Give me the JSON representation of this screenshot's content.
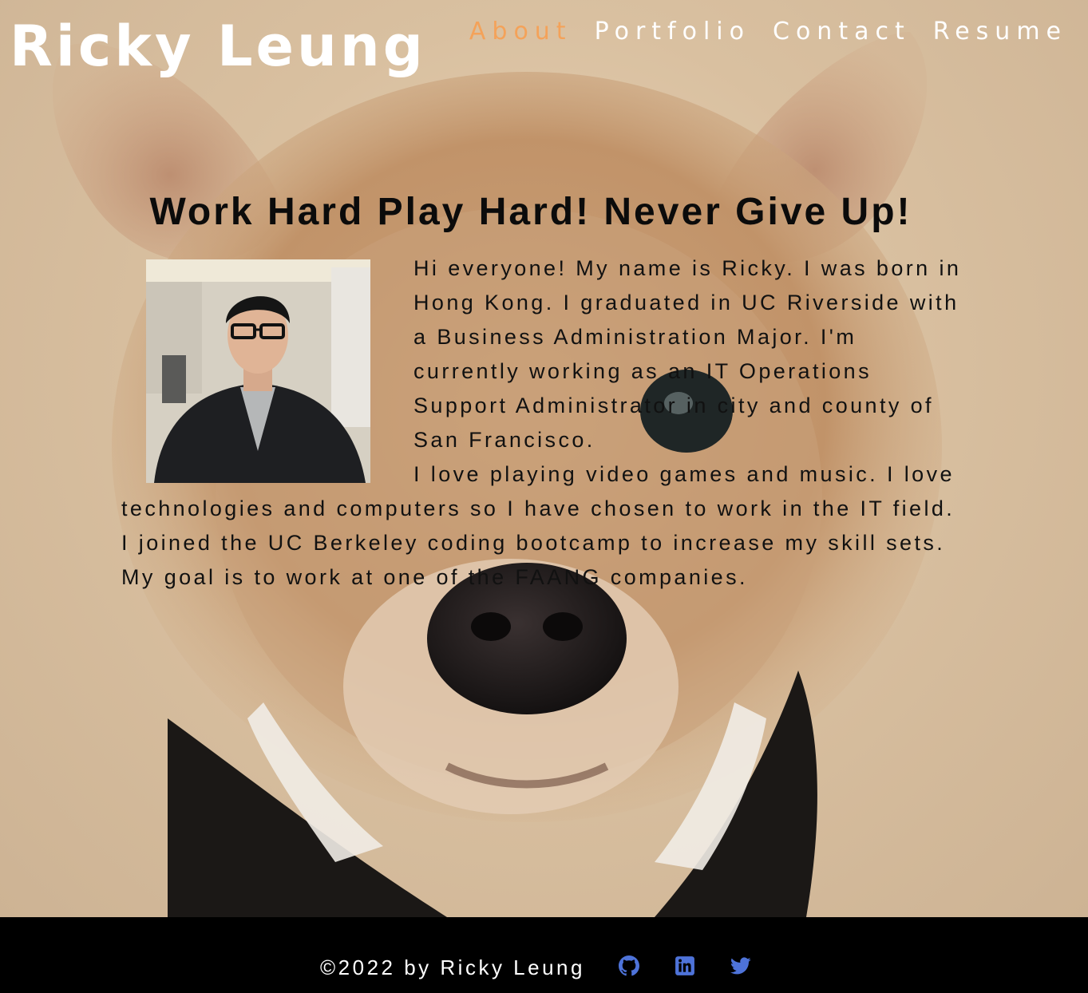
{
  "header": {
    "site_title": "Ricky Leung",
    "nav": [
      {
        "label": "About",
        "active": true
      },
      {
        "label": "Portfolio",
        "active": false
      },
      {
        "label": "Contact",
        "active": false
      },
      {
        "label": "Resume",
        "active": false
      }
    ]
  },
  "main": {
    "headline": "Work Hard Play Hard! Never Give Up!",
    "paragraphs": [
      "Hi everyone! My name is Ricky. I was born in Hong Kong. I graduated in UC Riverside with a Business Administration Major. I'm currently working as an IT Operations Support Administrator in city and county of San Francisco.",
      "I love playing video games and music. I love technologies and computers so I have chosen to work in the IT field.",
      "I joined the UC Berkeley coding bootcamp to increase my skill sets. My goal is to work at one of the FAANG companies."
    ]
  },
  "footer": {
    "copyright": "©2022 by Ricky Leung",
    "icons": [
      "github-icon",
      "linkedin-icon",
      "twitter-icon"
    ]
  },
  "colors": {
    "nav_active": "#f4a259",
    "nav_default": "#ffffff",
    "footer_bg": "#000000",
    "icon_accent": "#4e73d9"
  }
}
